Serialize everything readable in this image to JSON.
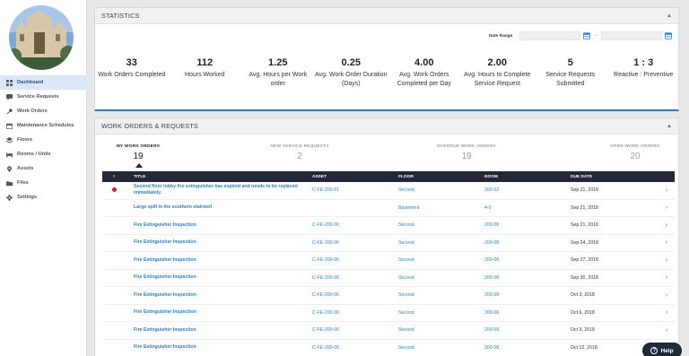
{
  "sidebar": {
    "items": [
      {
        "label": "Dashboard",
        "icon": "dashboard-icon"
      },
      {
        "label": "Service Requests",
        "icon": "service-request-icon"
      },
      {
        "label": "Work Orders",
        "icon": "wrench-icon"
      },
      {
        "label": "Maintenance Schedules",
        "icon": "calendar-icon"
      },
      {
        "label": "Floors",
        "icon": "layers-icon"
      },
      {
        "label": "Rooms / Units",
        "icon": "bed-icon"
      },
      {
        "label": "Assets",
        "icon": "map-pin-icon"
      },
      {
        "label": "Files",
        "icon": "folder-icon"
      },
      {
        "label": "Settings",
        "icon": "gear-icon"
      }
    ]
  },
  "statistics": {
    "title": "STATISTICS",
    "date_range_label": "Date Range",
    "date_from": "",
    "date_to": "",
    "date_separator": "–",
    "items": [
      {
        "value": "33",
        "label": "Work Orders Completed"
      },
      {
        "value": "112",
        "label": "Hours Worked"
      },
      {
        "value": "1.25",
        "label": "Avg. Hours per Work order"
      },
      {
        "value": "0.25",
        "label": "Avg. Work Order Duration (Days)"
      },
      {
        "value": "4.00",
        "label": "Avg. Work Orders Completed per Day"
      },
      {
        "value": "2.00",
        "label": "Avg. Hours to Complete Service Request"
      },
      {
        "value": "5",
        "label": "Service Requests Submitted"
      },
      {
        "value": "1 : 3",
        "label": "Reactive : Preventive"
      }
    ]
  },
  "orders": {
    "title": "WORK ORDERS & REQUESTS",
    "tabs": [
      {
        "label": "MY WORK ORDERS",
        "count": "19"
      },
      {
        "label": "NEW SERVICE REQUESTS",
        "count": "2"
      },
      {
        "label": "OVERDUE WORK ORDERS",
        "count": "19"
      },
      {
        "label": "OPEN WORK ORDERS",
        "count": "20"
      }
    ],
    "columns": {
      "flag": "!",
      "title": "TITLE",
      "asset": "ASSET",
      "floor": "FLOOR",
      "room": "ROOM",
      "due": "DUE DATE"
    },
    "rows": [
      {
        "flag": true,
        "title": "Second floor lobby fire extinguisher has expired and needs to be replaced immediately.",
        "asset": "C-FE-200-01",
        "floor": "Second",
        "room": "200-02",
        "due": "Sep 21, 2018"
      },
      {
        "flag": false,
        "title": "Large spill in the southern stairwell",
        "asset": "",
        "floor": "Basement",
        "room": "4-0",
        "due": "Sep 21, 2018"
      },
      {
        "flag": false,
        "title": "Fire Extinguisher Inspection",
        "asset": "C-FE-200-06",
        "floor": "Second",
        "room": "200-08",
        "due": "Sep 21, 2018"
      },
      {
        "flag": false,
        "title": "Fire Extinguisher Inspection",
        "asset": "C-FE-200-06",
        "floor": "Second",
        "room": "200-08",
        "due": "Sep 24, 2018"
      },
      {
        "flag": false,
        "title": "Fire Extinguisher Inspection",
        "asset": "C-FE-200-06",
        "floor": "Second",
        "room": "200-08",
        "due": "Sep 27, 2018"
      },
      {
        "flag": false,
        "title": "Fire Extinguisher Inspection",
        "asset": "C-FE-200-06",
        "floor": "Second",
        "room": "200-08",
        "due": "Sep 30, 2018"
      },
      {
        "flag": false,
        "title": "Fire Extinguisher Inspection",
        "asset": "C-FE-200-06",
        "floor": "Second",
        "room": "200-08",
        "due": "Oct 3, 2018"
      },
      {
        "flag": false,
        "title": "Fire Extinguisher Inspection",
        "asset": "C-FE-200-06",
        "floor": "Second",
        "room": "200-08",
        "due": "Oct 6, 2018"
      },
      {
        "flag": false,
        "title": "Fire Extinguisher Inspection",
        "asset": "C-FE-200-06",
        "floor": "Second",
        "room": "200-08",
        "due": "Oct 9, 2018"
      },
      {
        "flag": false,
        "title": "Fire Extinguisher Inspection",
        "asset": "C-FE-200-06",
        "floor": "Second",
        "room": "200-08",
        "due": "Oct 12, 2018"
      }
    ]
  },
  "help": {
    "label": "Help",
    "icon": "question-icon"
  },
  "colors": {
    "accent": "#3a78c2",
    "link": "#2a80c8",
    "header_dark": "#232836",
    "alert": "#d91c1c"
  }
}
